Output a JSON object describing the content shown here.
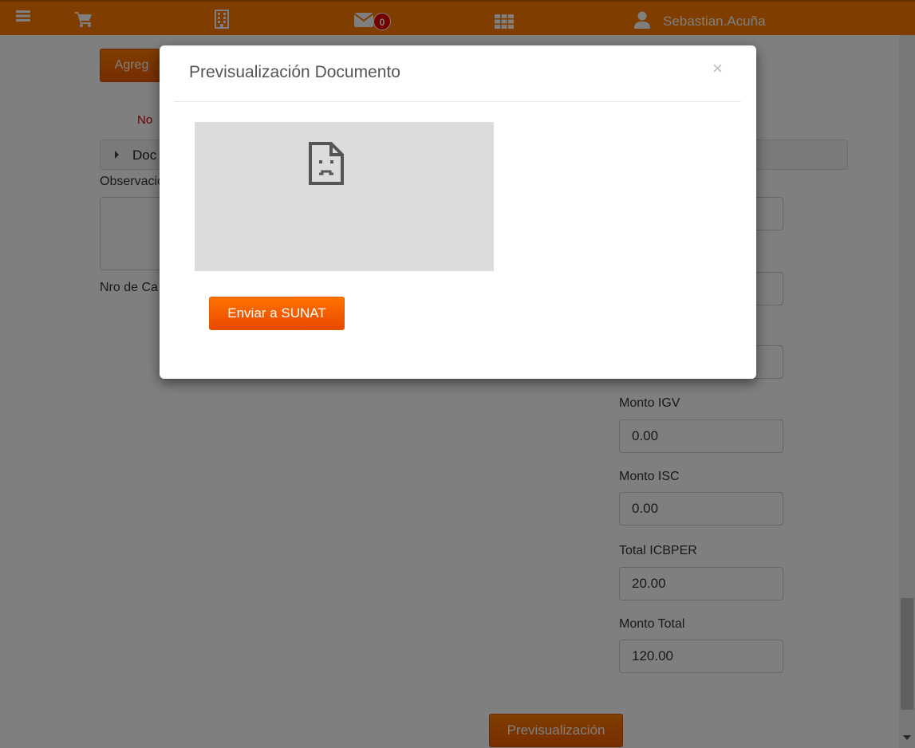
{
  "topbar": {
    "icons": [
      "menu-icon",
      "cart-icon",
      "building-icon",
      "envelope-icon",
      "grid-icon",
      "user-icon"
    ],
    "mail_badge": "0",
    "username": "Sebastian.Acuña",
    "accent_color": "#ff7a00"
  },
  "page": {
    "add_button_label": "Agreg",
    "red_note": "No",
    "accordion_label": "Doc",
    "observations_label": "Observacio",
    "nro_label": "Nro de Ca",
    "fields": [
      {
        "label": "Monto IGV",
        "value": "0.00"
      },
      {
        "label": "Monto ISC",
        "value": "0.00"
      },
      {
        "label": "Total ICBPER",
        "value": "20.00"
      },
      {
        "label": "Monto Total",
        "value": "120.00"
      }
    ],
    "preview_button_label": "Previsualización"
  },
  "modal": {
    "title": "Previsualización Documento",
    "close_glyph": "×",
    "send_button_label": "Enviar a SUNAT",
    "preview_icon": "broken-document-icon"
  }
}
